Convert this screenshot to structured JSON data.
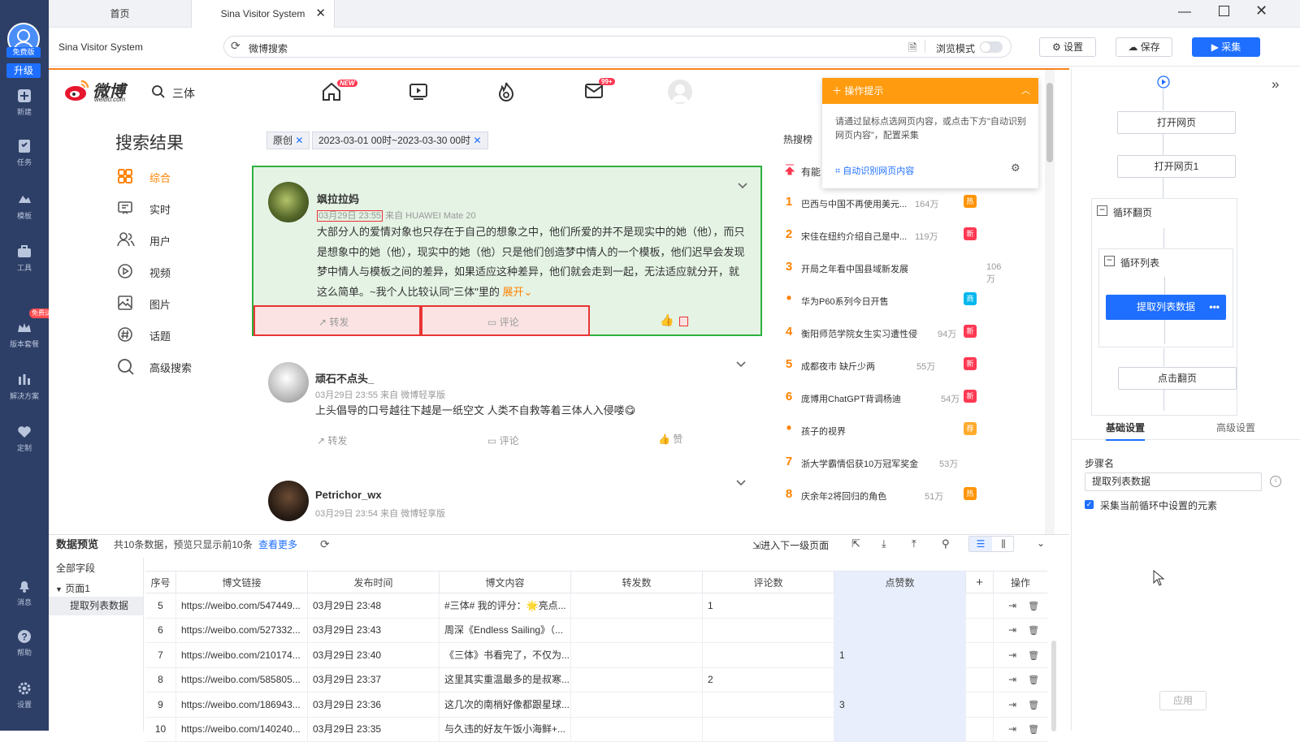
{
  "sidebar": {
    "badge": "免费版",
    "upgrade": "升级",
    "items": [
      {
        "label": "新建",
        "icon": "plus-square-icon"
      },
      {
        "label": "任务",
        "icon": "bookmark-icon"
      },
      {
        "label": "模板",
        "icon": "template-icon"
      },
      {
        "label": "工具",
        "icon": "toolbox-icon"
      },
      {
        "label": "版本套餐",
        "icon": "crown-icon",
        "tag": "免费试用"
      },
      {
        "label": "解决方案",
        "icon": "chart-icon"
      },
      {
        "label": "定制",
        "icon": "heart-icon"
      },
      {
        "label": "消息",
        "icon": "bell-icon"
      },
      {
        "label": "帮助",
        "icon": "help-icon"
      },
      {
        "label": "设置",
        "icon": "gear-icon"
      }
    ]
  },
  "tabs": [
    {
      "label": "首页"
    },
    {
      "label": "Sina Visitor System"
    }
  ],
  "toolbar": {
    "page_title": "Sina Visitor System",
    "url": "微博搜索",
    "browse_mode": "浏览模式",
    "settings": "设置",
    "save": "保存",
    "collect": "采集"
  },
  "weibo": {
    "logo_text": "微博",
    "logo_sub": "weibo.com",
    "search_text": "三体",
    "new_badge": "NEW",
    "msg_badge": "99+",
    "results_title": "搜索结果",
    "menu": [
      {
        "label": "综合",
        "icon": "grid-icon",
        "active": true
      },
      {
        "label": "实时",
        "icon": "realtime-icon"
      },
      {
        "label": "用户",
        "icon": "users-icon"
      },
      {
        "label": "视频",
        "icon": "play-icon"
      },
      {
        "label": "图片",
        "icon": "image-icon"
      },
      {
        "label": "话题",
        "icon": "hashtag-icon"
      },
      {
        "label": "高级搜索",
        "icon": "search-icon"
      }
    ],
    "filters": [
      "原创",
      "2023-03-01 00时~2023-03-30 00时"
    ],
    "posts": [
      {
        "user": "飒拉拉妈",
        "time": "03月29日 23:55",
        "source": "来自 HUAWEI Mate 20",
        "text": "大部分人的爱情对象也只存在于自己的想象之中，他们所爱的并不是现实中的她（他），而只是想象中的她（他），现实中的她（他）只是他们创造梦中情人的一个模板，他们迟早会发现梦中情人与模板之间的差异，如果适应这种差异，他们就会走到一起，无法适应就分开，就这么简单。~我个人比较认同\"三体\"里的",
        "expand": "展开",
        "repost": "转发",
        "comment": "评论"
      },
      {
        "user": "顽石不点头_",
        "time": "03月29日 23:55",
        "source": "来自 微博轻享版",
        "text": "上头倡导的口号越往下越是一纸空文 人类不自救等着三体人入侵喽😋",
        "repost": "转发",
        "comment": "评论",
        "like": "赞"
      },
      {
        "user": "Petrichor_wx",
        "time": "03月29日 23:54",
        "source": "来自 微博轻享版"
      }
    ],
    "hot_title": "热搜榜",
    "hot_top": "有能",
    "hot": [
      {
        "rank": "1",
        "title": "巴西与中国不再使用美元...",
        "count": "164万",
        "badge": "热",
        "color": "#ff9406"
      },
      {
        "rank": "2",
        "title": "宋佳在纽约介绍自己是中...",
        "count": "119万",
        "badge": "新",
        "color": "#ff3852"
      },
      {
        "rank": "3",
        "title": "开局之年看中国县域新发展",
        "count": "106万",
        "badge": "",
        "color": ""
      },
      {
        "rank": "•",
        "title": "华为P60系列今日开售",
        "count": "",
        "badge": "商",
        "color": "#00b7ee"
      },
      {
        "rank": "4",
        "title": "衡阳师范学院女生实习遭性侵",
        "count": "94万",
        "badge": "新",
        "color": "#ff3852"
      },
      {
        "rank": "5",
        "title": "成都夜市 缺斤少两",
        "count": "55万",
        "badge": "新",
        "color": "#ff3852"
      },
      {
        "rank": "6",
        "title": "庞博用ChatGPT背调杨迪",
        "count": "54万",
        "badge": "新",
        "color": "#ff3852"
      },
      {
        "rank": "•",
        "title": "孩子的视界",
        "count": "",
        "badge": "荐",
        "color": "#ffab2d"
      },
      {
        "rank": "7",
        "title": "浙大学霸情侣获10万冠军奖金",
        "count": "53万",
        "badge": "",
        "color": ""
      },
      {
        "rank": "8",
        "title": "庆余年2将回归的角色",
        "count": "51万",
        "badge": "热",
        "color": "#ff9406"
      }
    ]
  },
  "tip": {
    "title": "操作提示",
    "body": "请通过鼠标点选网页内容，或点击下方\"自动识别网页内容\"，配置采集",
    "link": "自动识别网页内容"
  },
  "flow": {
    "steps": [
      "打开网页",
      "打开网页1"
    ],
    "loop_page": "循环翻页",
    "loop_list": "循环列表",
    "extract": "提取列表数据",
    "next_page": "点击翻页"
  },
  "props": {
    "tab_basic": "基础设置",
    "tab_advanced": "高级设置",
    "step_label": "步骤名",
    "step_name": "提取列表数据",
    "checkbox": "采集当前循环中设置的元素",
    "apply": "应用"
  },
  "preview": {
    "title": "数据预览",
    "summary": "共10条数据，预览只显示前10条",
    "more": "查看更多",
    "next_level": "进入下一级页面",
    "tree_all": "全部字段",
    "tree_page": "页面1",
    "tree_item": "提取列表数据",
    "columns": [
      "序号",
      "博文链接",
      "发布时间",
      "博文内容",
      "转发数",
      "评论数",
      "点赞数",
      "+",
      "操作"
    ],
    "rows": [
      {
        "n": "5",
        "link": "https://weibo.com/547449...",
        "time": "03月29日 23:48",
        "content": "#三体# 我的评分：🌟亮点...",
        "repost": "",
        "comment": "1",
        "like": ""
      },
      {
        "n": "6",
        "link": "https://weibo.com/527332...",
        "time": "03月29日 23:43",
        "content": "周深《Endless Sailing》（...",
        "repost": "",
        "comment": "",
        "like": ""
      },
      {
        "n": "7",
        "link": "https://weibo.com/210174...",
        "time": "03月29日 23:40",
        "content": "《三体》书看完了，不仅为...",
        "repost": "",
        "comment": "",
        "like": "1"
      },
      {
        "n": "8",
        "link": "https://weibo.com/585805...",
        "time": "03月29日 23:37",
        "content": "这里其实重温最多的是叔寒...",
        "repost": "",
        "comment": "2",
        "like": ""
      },
      {
        "n": "9",
        "link": "https://weibo.com/186943...",
        "time": "03月29日 23:36",
        "content": "这几次的南梢好像都跟星球...",
        "repost": "",
        "comment": "",
        "like": "3"
      },
      {
        "n": "10",
        "link": "https://weibo.com/140240...",
        "time": "03月29日 23:35",
        "content": "与久违的好友午饭小海鲜+...",
        "repost": "",
        "comment": "",
        "like": ""
      }
    ]
  }
}
